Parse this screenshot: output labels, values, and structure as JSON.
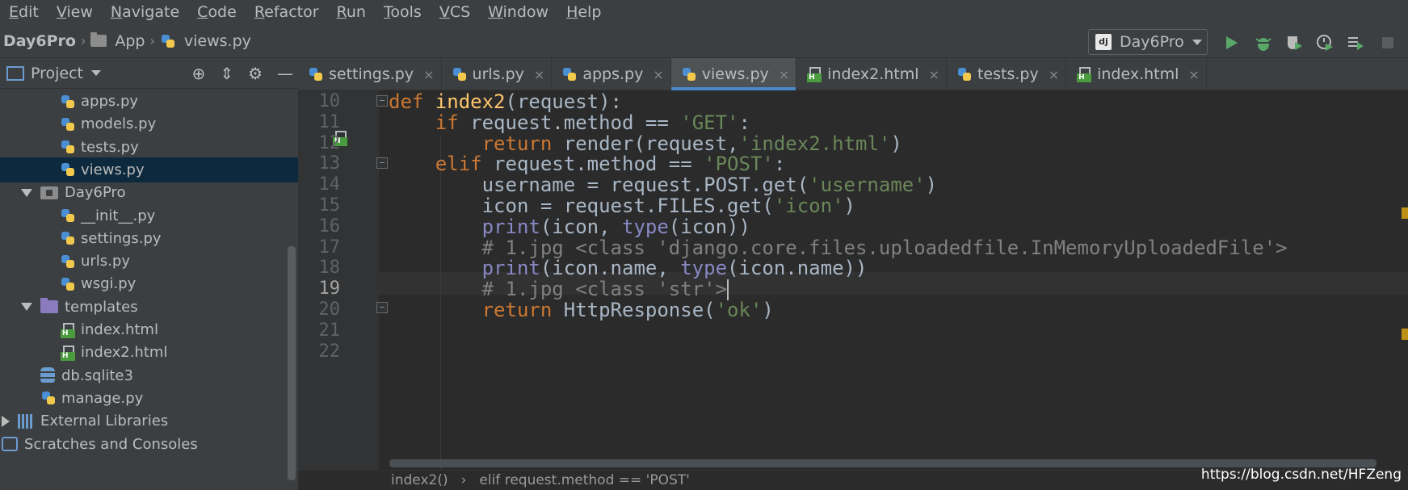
{
  "menu": [
    "Edit",
    "View",
    "Navigate",
    "Code",
    "Refactor",
    "Run",
    "Tools",
    "VCS",
    "Window",
    "Help"
  ],
  "breadcrumb": {
    "project": "Day6Pro",
    "folder": "App",
    "file": "views.py"
  },
  "run_config": {
    "label": "Day6Pro",
    "icon": "dj"
  },
  "project_panel": {
    "title": "Project"
  },
  "tree": [
    {
      "label": "apps.py",
      "type": "py",
      "indent": 2
    },
    {
      "label": "models.py",
      "type": "py",
      "indent": 2
    },
    {
      "label": "tests.py",
      "type": "py",
      "indent": 2
    },
    {
      "label": "views.py",
      "type": "py",
      "indent": 2,
      "selected": true
    },
    {
      "label": "Day6Pro",
      "type": "folder-grey",
      "indent": 1,
      "expanded": true
    },
    {
      "label": "__init__.py",
      "type": "py",
      "indent": 2
    },
    {
      "label": "settings.py",
      "type": "py",
      "indent": 2
    },
    {
      "label": "urls.py",
      "type": "py",
      "indent": 2
    },
    {
      "label": "wsgi.py",
      "type": "py",
      "indent": 2
    },
    {
      "label": "templates",
      "type": "folder-purple",
      "indent": 1,
      "expanded": true
    },
    {
      "label": "index.html",
      "type": "html",
      "indent": 2
    },
    {
      "label": "index2.html",
      "type": "html",
      "indent": 2
    },
    {
      "label": "db.sqlite3",
      "type": "db",
      "indent": 1
    },
    {
      "label": "manage.py",
      "type": "py",
      "indent": 1
    },
    {
      "label": "External Libraries",
      "type": "lib",
      "indent": 0,
      "collapsed": true
    },
    {
      "label": "Scratches and Consoles",
      "type": "scratch",
      "indent": 0
    }
  ],
  "tabs": [
    {
      "label": "settings.py",
      "type": "py"
    },
    {
      "label": "urls.py",
      "type": "py"
    },
    {
      "label": "apps.py",
      "type": "py"
    },
    {
      "label": "views.py",
      "type": "py",
      "active": true
    },
    {
      "label": "index2.html",
      "type": "html"
    },
    {
      "label": "tests.py",
      "type": "py"
    },
    {
      "label": "index.html",
      "type": "html"
    }
  ],
  "code": {
    "line_numbers": [
      "10",
      "11",
      "12",
      "13",
      "14",
      "15",
      "16",
      "17",
      "18",
      "19",
      "20",
      "21",
      "22"
    ],
    "current_line": "19",
    "lines": [
      [
        [
          "kw",
          "def "
        ],
        [
          "fn",
          "index2"
        ],
        [
          "",
          "(request):"
        ]
      ],
      [
        [
          "",
          "    "
        ],
        [
          "kw",
          "if "
        ],
        [
          "",
          "request.method == "
        ],
        [
          "str",
          "'GET'"
        ],
        [
          "",
          ":"
        ]
      ],
      [
        [
          "",
          "        "
        ],
        [
          "kw",
          "return "
        ],
        [
          "",
          "render(request,"
        ],
        [
          "str",
          "'index2.html'"
        ],
        [
          "",
          ")"
        ]
      ],
      [
        [
          "",
          "    "
        ],
        [
          "kw",
          "elif "
        ],
        [
          "",
          "request.method == "
        ],
        [
          "str",
          "'POST'"
        ],
        [
          "",
          ":"
        ]
      ],
      [
        [
          "",
          "        username = request.POST.get("
        ],
        [
          "str",
          "'username'"
        ],
        [
          "",
          ")"
        ]
      ],
      [
        [
          "",
          "        icon = request.FILES.get("
        ],
        [
          "str",
          "'icon'"
        ],
        [
          "",
          ")"
        ]
      ],
      [
        [
          "",
          "        "
        ],
        [
          "bi",
          "print"
        ],
        [
          "",
          "(icon, "
        ],
        [
          "bi",
          "type"
        ],
        [
          "",
          "(icon))"
        ]
      ],
      [
        [
          "",
          "        "
        ],
        [
          "cmt",
          "# 1.jpg <class 'django.core.files.uploadedfile.InMemoryUploadedFile'>"
        ]
      ],
      [
        [
          "",
          "        "
        ],
        [
          "bi",
          "print"
        ],
        [
          "",
          "(icon.name, "
        ],
        [
          "bi",
          "type"
        ],
        [
          "",
          "(icon.name))"
        ]
      ],
      [
        [
          "",
          "        "
        ],
        [
          "cmt",
          "# 1.jpg <class 'str'>"
        ]
      ],
      [
        [
          "",
          "        "
        ],
        [
          "kw",
          "return "
        ],
        [
          "",
          "HttpResponse("
        ],
        [
          "str",
          "'ok'"
        ],
        [
          "",
          ")"
        ]
      ],
      [
        [
          "",
          ""
        ]
      ],
      [
        [
          "",
          ""
        ]
      ]
    ]
  },
  "bottom_breadcrumb": {
    "fn": "index2()",
    "sep": "›",
    "stmt": "elif request.method == 'POST'"
  },
  "watermark": "https://blog.csdn.net/HFZeng",
  "colors": {
    "keyword": "#cc7832",
    "function": "#ffc66d",
    "string": "#6a8759",
    "comment": "#808080",
    "builtin": "#8888c6",
    "accent": "#4a88c7"
  }
}
